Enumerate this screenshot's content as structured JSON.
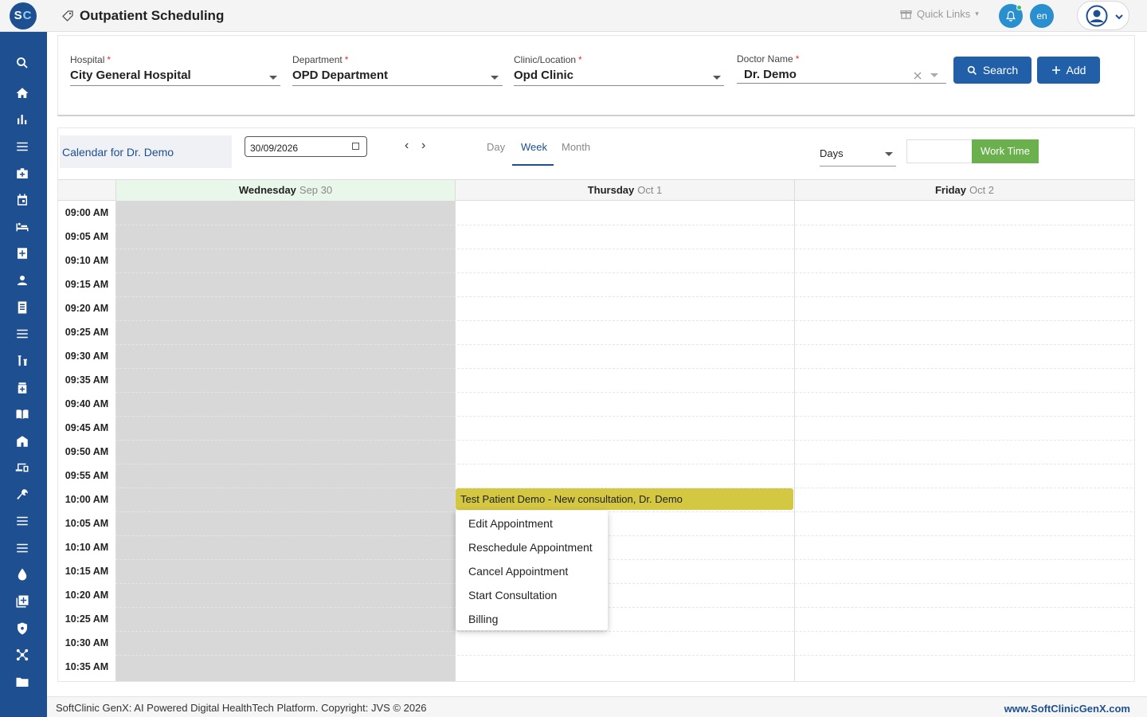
{
  "app": {
    "logo_text": "SC",
    "page_title": "Outpatient Scheduling",
    "quick_links_label": "Quick Links",
    "language_code": "en"
  },
  "sidebar": {
    "items": [
      {
        "icon": "search-icon"
      },
      {
        "icon": "home-icon"
      },
      {
        "icon": "bar-chart-icon"
      },
      {
        "icon": "menu-icon"
      },
      {
        "icon": "medical-kit-icon"
      },
      {
        "icon": "calendar-icon"
      },
      {
        "icon": "bed-icon"
      },
      {
        "icon": "medical-plus-icon"
      },
      {
        "icon": "person-icon"
      },
      {
        "icon": "document-icon"
      },
      {
        "icon": "list-icon"
      },
      {
        "icon": "lab-vials-icon"
      },
      {
        "icon": "pharmacy-icon"
      },
      {
        "icon": "book-icon"
      },
      {
        "icon": "building-icon"
      },
      {
        "icon": "devices-icon"
      },
      {
        "icon": "wrench-icon"
      },
      {
        "icon": "menu-icon-2"
      },
      {
        "icon": "menu-icon-3"
      },
      {
        "icon": "blood-drop-icon"
      },
      {
        "icon": "add-library-icon"
      },
      {
        "icon": "shield-icon"
      },
      {
        "icon": "network-icon"
      },
      {
        "icon": "folder-icon"
      }
    ]
  },
  "filters": {
    "hospital": {
      "label": "Hospital",
      "value": "City General Hospital"
    },
    "department": {
      "label": "Department",
      "value": "OPD Department"
    },
    "clinic": {
      "label": "Clinic/Location",
      "value": "Opd Clinic"
    },
    "doctor": {
      "label": "Doctor Name",
      "value": "Dr. Demo"
    },
    "required_mark": "*",
    "search_label": "Search",
    "add_label": "Add"
  },
  "calendar": {
    "title": "Calendar for Dr. Demo",
    "date": "30/09/2026",
    "view_tabs": [
      "Day",
      "Week",
      "Month"
    ],
    "active_view": "Week",
    "unit_select": "Days",
    "work_time_label": "Work Time",
    "days": [
      {
        "name": "Wednesday",
        "date": "Sep 30",
        "today": true,
        "closed": true
      },
      {
        "name": "Thursday",
        "date": "Oct 1",
        "today": false,
        "closed": false
      },
      {
        "name": "Friday",
        "date": "Oct 2",
        "today": false,
        "closed": false
      }
    ],
    "time_slots": [
      "09:00 AM",
      "09:05 AM",
      "09:10 AM",
      "09:15 AM",
      "09:20 AM",
      "09:25 AM",
      "09:30 AM",
      "09:35 AM",
      "09:40 AM",
      "09:45 AM",
      "09:50 AM",
      "09:55 AM",
      "10:00 AM",
      "10:05 AM",
      "10:10 AM",
      "10:15 AM",
      "10:20 AM",
      "10:25 AM",
      "10:30 AM",
      "10:35 AM"
    ],
    "event": {
      "text": "Test Patient Demo - New consultation, Dr. Demo",
      "day": "Thursday",
      "time": "10:00 AM",
      "color": "#d4c741"
    }
  },
  "context_menu": {
    "items": [
      "Edit Appointment",
      "Reschedule Appointment",
      "Cancel Appointment",
      "Start Consultation",
      "Billing"
    ]
  },
  "footer": {
    "copyright": "SoftClinic GenX: AI Powered Digital HealthTech Platform. Copyright: JVS © 2026",
    "website": "www.SoftClinicGenX.com"
  },
  "colors": {
    "brand": "#1d4f91",
    "button": "#2160a8",
    "work_time": "#6ab04c",
    "event": "#d4c741",
    "today_header": "#e8f7e9",
    "closed_day": "#d8d8d8"
  }
}
